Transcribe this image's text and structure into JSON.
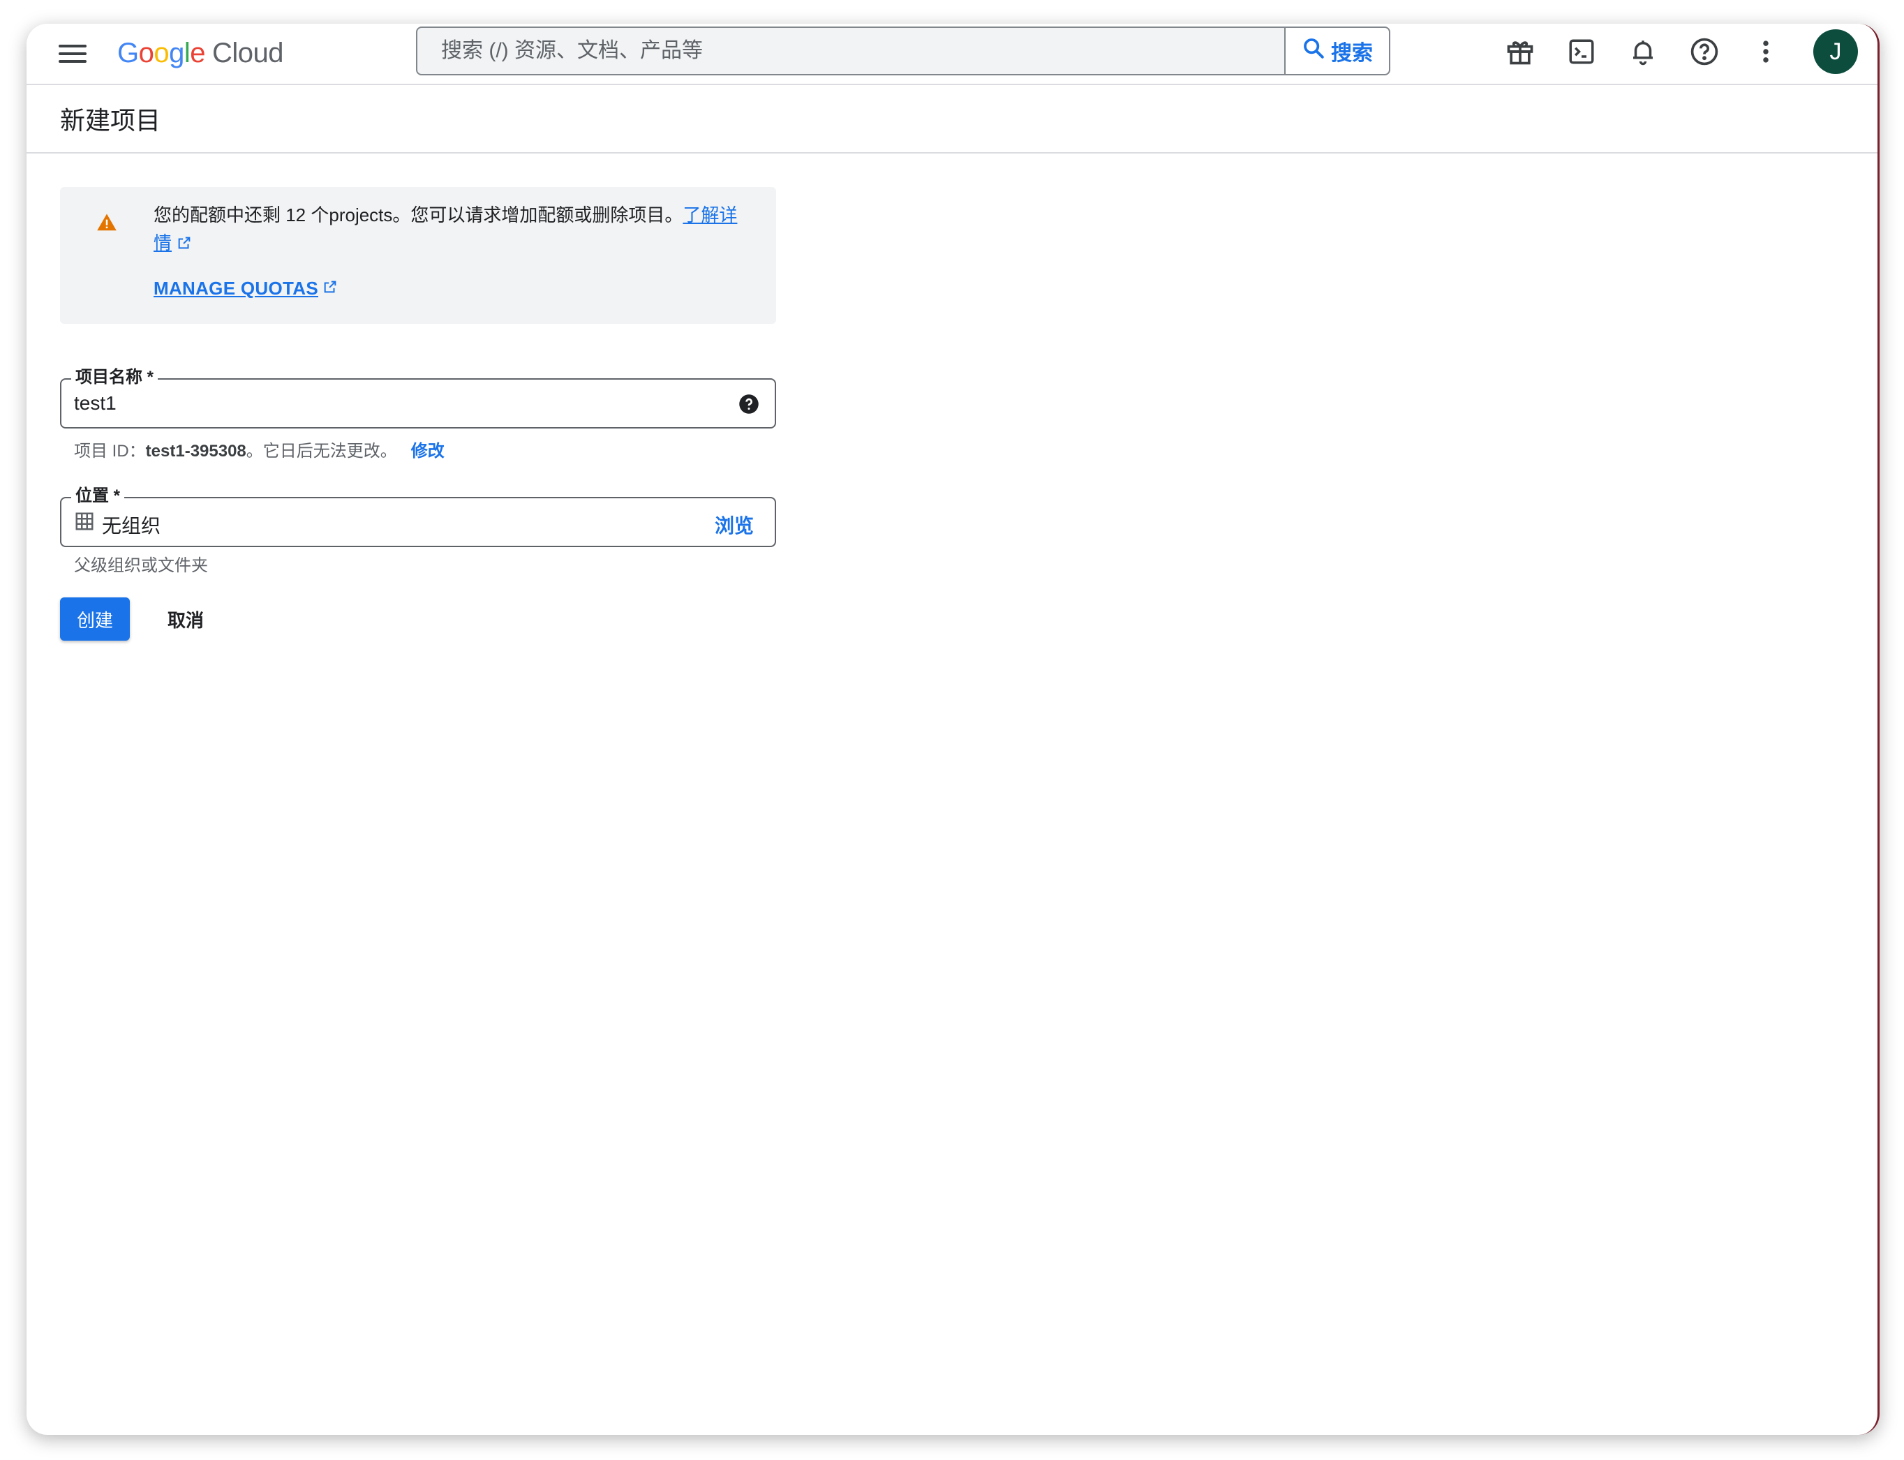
{
  "app": {
    "logo_letters": [
      "G",
      "o",
      "o",
      "g",
      "l",
      "e"
    ],
    "logo_suffix": "Cloud"
  },
  "search": {
    "placeholder": "搜索 (/) 资源、文档、产品等",
    "button_label": "搜索"
  },
  "topbar_icons": [
    "gift-icon",
    "cloud-shell-icon",
    "notifications-icon",
    "help-icon",
    "more-vert-icon"
  ],
  "user": {
    "avatar_initial": "J",
    "avatar_color": "#0d4d3e"
  },
  "page": {
    "title": "新建项目"
  },
  "alert": {
    "text": "您的配额中还剩 12 个projects。您可以请求增加配额或删除项目。",
    "learn_more": "了解详情",
    "manage_quotas": "MANAGE QUOTAS"
  },
  "project_name": {
    "label": "项目名称 *",
    "value": "test1",
    "id_prefix": "项目 ID：",
    "id_value": "test1-395308",
    "id_suffix": "。它日后无法更改。",
    "edit_label": "修改"
  },
  "location": {
    "label": "位置 *",
    "value": "无组织",
    "browse_label": "浏览",
    "hint": "父级组织或文件夹"
  },
  "actions": {
    "create": "创建",
    "cancel": "取消"
  },
  "colors": {
    "accent": "#1a73e8",
    "warning": "#e37400"
  }
}
